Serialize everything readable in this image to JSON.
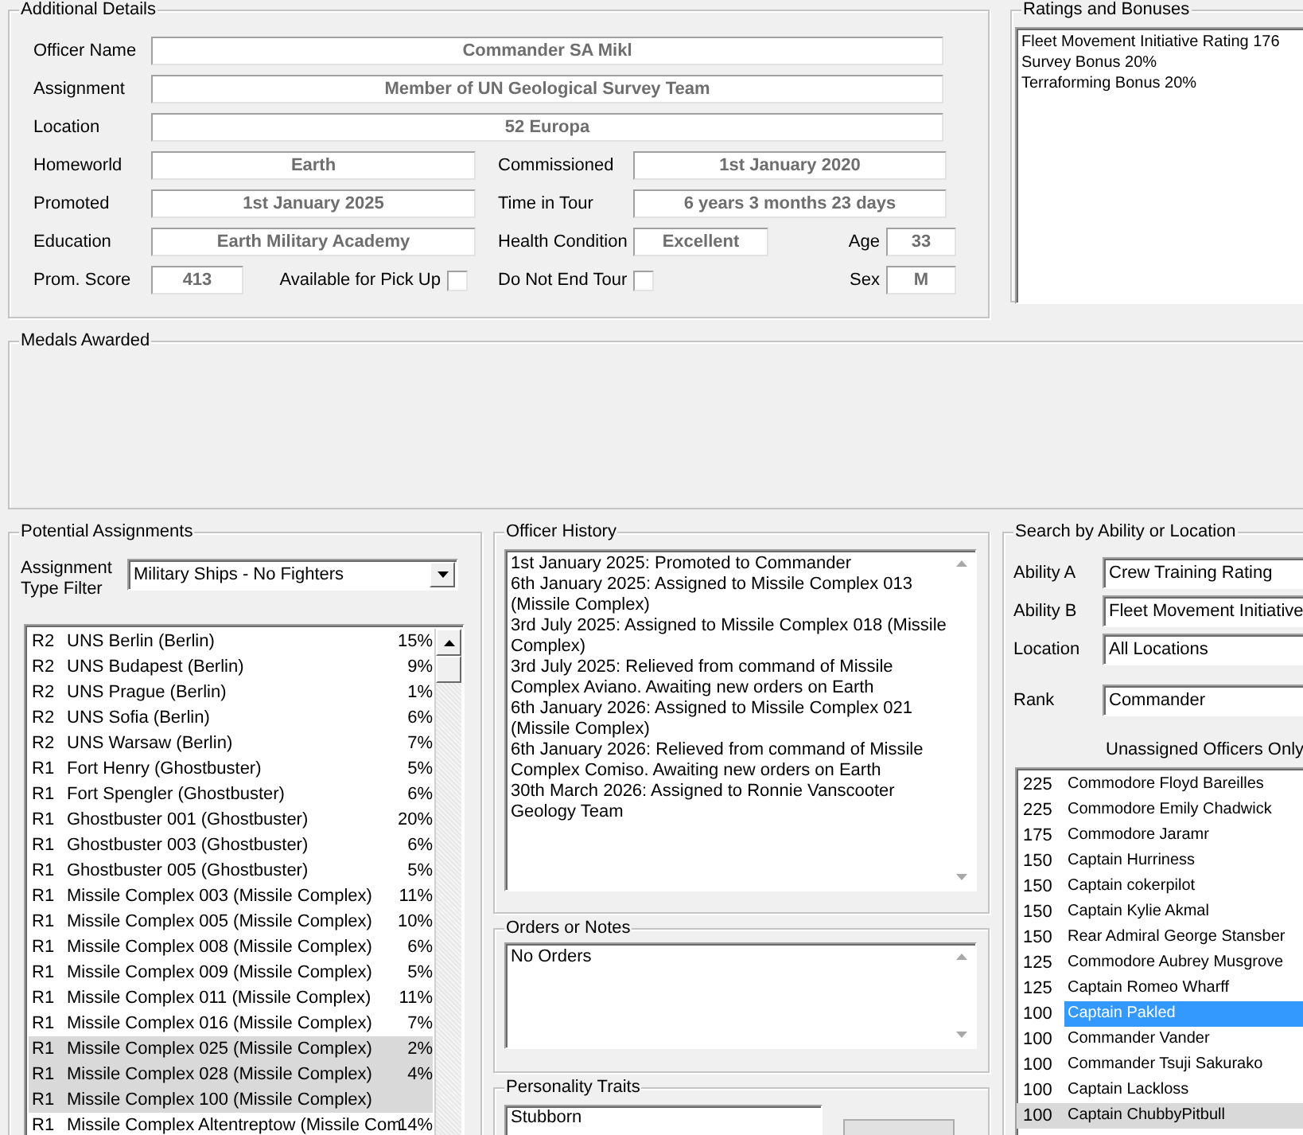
{
  "details": {
    "title": "Additional Details",
    "rows": [
      {
        "kind": "wide",
        "label": "Officer Name",
        "value": "Commander SA Mikl"
      },
      {
        "kind": "wide",
        "label": "Assignment",
        "value": "Member of UN Geological Survey Team"
      },
      {
        "kind": "wide",
        "label": "Location",
        "value": "52 Europa"
      },
      {
        "kind": "pair",
        "left": {
          "label": "Homeworld",
          "value": "Earth"
        },
        "right": {
          "label": "Commissioned",
          "value": "1st January 2020"
        }
      },
      {
        "kind": "pair",
        "left": {
          "label": "Promoted",
          "value": "1st January 2025"
        },
        "right": {
          "label": "Time in Tour",
          "value": "6 years 3 months 23 days"
        }
      },
      {
        "kind": "health",
        "left": {
          "label": "Education",
          "value": "Earth Military Academy"
        },
        "mid": {
          "label": "Health Condition",
          "value": "Excellent"
        },
        "right": {
          "label": "Age",
          "value": "33"
        }
      },
      {
        "kind": "flags",
        "left": {
          "label": "Prom. Score",
          "value": "413"
        },
        "checks": [
          {
            "label": "Available for Pick Up",
            "checked": false
          },
          {
            "label": "Do Not End Tour",
            "checked": false
          }
        ],
        "right": {
          "label": "Sex",
          "value": "M"
        }
      }
    ]
  },
  "ratings": {
    "title": "Ratings and Bonuses",
    "lines": [
      "Fleet Movement Initiative Rating 176",
      "Survey Bonus 20%",
      "Terraforming Bonus 20%"
    ]
  },
  "medals": {
    "title": "Medals Awarded"
  },
  "assignments": {
    "title": "Potential Assignments",
    "filter": {
      "label": "Assignment Type Filter",
      "value": "Military Ships - No Fighters"
    },
    "rows": [
      {
        "rank": "R2",
        "name": "UNS Berlin (Berlin)",
        "chance": "15%",
        "selected": false
      },
      {
        "rank": "R2",
        "name": "UNS Budapest (Berlin)",
        "chance": "9%",
        "selected": false
      },
      {
        "rank": "R2",
        "name": "UNS Prague (Berlin)",
        "chance": "1%",
        "selected": false
      },
      {
        "rank": "R2",
        "name": "UNS Sofia (Berlin)",
        "chance": "6%",
        "selected": false
      },
      {
        "rank": "R2",
        "name": "UNS Warsaw (Berlin)",
        "chance": "7%",
        "selected": false
      },
      {
        "rank": "R1",
        "name": "Fort Henry (Ghostbuster)",
        "chance": "5%",
        "selected": false
      },
      {
        "rank": "R1",
        "name": "Fort Spengler (Ghostbuster)",
        "chance": "6%",
        "selected": false
      },
      {
        "rank": "R1",
        "name": "Ghostbuster 001 (Ghostbuster)",
        "chance": "20%",
        "selected": false
      },
      {
        "rank": "R1",
        "name": "Ghostbuster 003 (Ghostbuster)",
        "chance": "6%",
        "selected": false
      },
      {
        "rank": "R1",
        "name": "Ghostbuster 005 (Ghostbuster)",
        "chance": "5%",
        "selected": false
      },
      {
        "rank": "R1",
        "name": "Missile Complex 003 (Missile Complex)",
        "chance": "11%",
        "selected": false
      },
      {
        "rank": "R1",
        "name": "Missile Complex 005 (Missile Complex)",
        "chance": "10%",
        "selected": false
      },
      {
        "rank": "R1",
        "name": "Missile Complex 008 (Missile Complex)",
        "chance": "6%",
        "selected": false
      },
      {
        "rank": "R1",
        "name": "Missile Complex 009 (Missile Complex)",
        "chance": "5%",
        "selected": false
      },
      {
        "rank": "R1",
        "name": "Missile Complex 011 (Missile Complex)",
        "chance": "11%",
        "selected": false
      },
      {
        "rank": "R1",
        "name": "Missile Complex 016 (Missile Complex)",
        "chance": "7%",
        "selected": false
      },
      {
        "rank": "R1",
        "name": "Missile Complex 025 (Missile Complex)",
        "chance": "2%",
        "selected": true
      },
      {
        "rank": "R1",
        "name": "Missile Complex 028 (Missile Complex)",
        "chance": "4%",
        "selected": true
      },
      {
        "rank": "R1",
        "name": "Missile Complex 100 (Missile Complex)",
        "selected": true
      },
      {
        "rank": "R1",
        "name": "Missile Complex Altentreptow (Missile Com",
        "chance": "14%",
        "selected": false
      }
    ]
  },
  "history": {
    "title": "Officer History",
    "entries": [
      "1st January 2025: Promoted to Commander",
      "6th January 2025: Assigned to Missile Complex 013 (Missile Complex)",
      "3rd July 2025: Assigned to Missile Complex 018 (Missile Complex)",
      "3rd July 2025: Relieved from command of Missile Complex Aviano. Awaiting new orders on Earth",
      "6th January 2026: Assigned to Missile Complex 021 (Missile Complex)",
      "6th January 2026: Relieved from command of Missile Complex Comiso. Awaiting new orders on Earth",
      "30th March 2026: Assigned to Ronnie Vanscooter Geology Team"
    ]
  },
  "orders": {
    "title": "Orders or Notes",
    "text": "No Orders"
  },
  "traits": {
    "title": "Personality Traits",
    "items": [
      "Stubborn"
    ]
  },
  "search": {
    "title": "Search by Ability or Location",
    "fields": [
      {
        "label": "Ability A",
        "value": "Crew Training Rating"
      },
      {
        "label": "Ability B",
        "value": "Fleet Movement Initiative"
      },
      {
        "label": "Location",
        "value": "All Locations"
      },
      {
        "label": "Rank",
        "value": "Commander"
      }
    ],
    "unassigned_label": "Unassigned Officers Only",
    "officers": [
      {
        "score": "225",
        "name": "Commodore Floyd Bareilles",
        "selected": false,
        "highlighted": false
      },
      {
        "score": "225",
        "name": "Commodore Emily Chadwick",
        "selected": false,
        "highlighted": false
      },
      {
        "score": "175",
        "name": "Commodore Jaramr",
        "selected": false,
        "highlighted": false
      },
      {
        "score": "150",
        "name": "Captain Hurriness",
        "selected": false,
        "highlighted": false
      },
      {
        "score": "150",
        "name": "Captain cokerpilot",
        "selected": false,
        "highlighted": false
      },
      {
        "score": "150",
        "name": "Captain Kylie Akmal",
        "selected": false,
        "highlighted": false
      },
      {
        "score": "150",
        "name": "Rear Admiral George Stansber",
        "selected": false,
        "highlighted": false
      },
      {
        "score": "125",
        "name": "Commodore Aubrey Musgrove",
        "selected": false,
        "highlighted": false
      },
      {
        "score": "125",
        "name": "Captain Romeo Wharff",
        "selected": false,
        "highlighted": false
      },
      {
        "score": "100",
        "name": "Captain Pakled",
        "selected": true,
        "highlighted": false
      },
      {
        "score": "100",
        "name": "Commander Vander",
        "selected": false,
        "highlighted": false
      },
      {
        "score": "100",
        "name": "Commander Tsuji Sakurako",
        "selected": false,
        "highlighted": false
      },
      {
        "score": "100",
        "name": "Captain Lackloss",
        "selected": false,
        "highlighted": false
      },
      {
        "score": "100",
        "name": "Captain ChubbyPitbull",
        "selected": false,
        "highlighted": true
      }
    ]
  }
}
